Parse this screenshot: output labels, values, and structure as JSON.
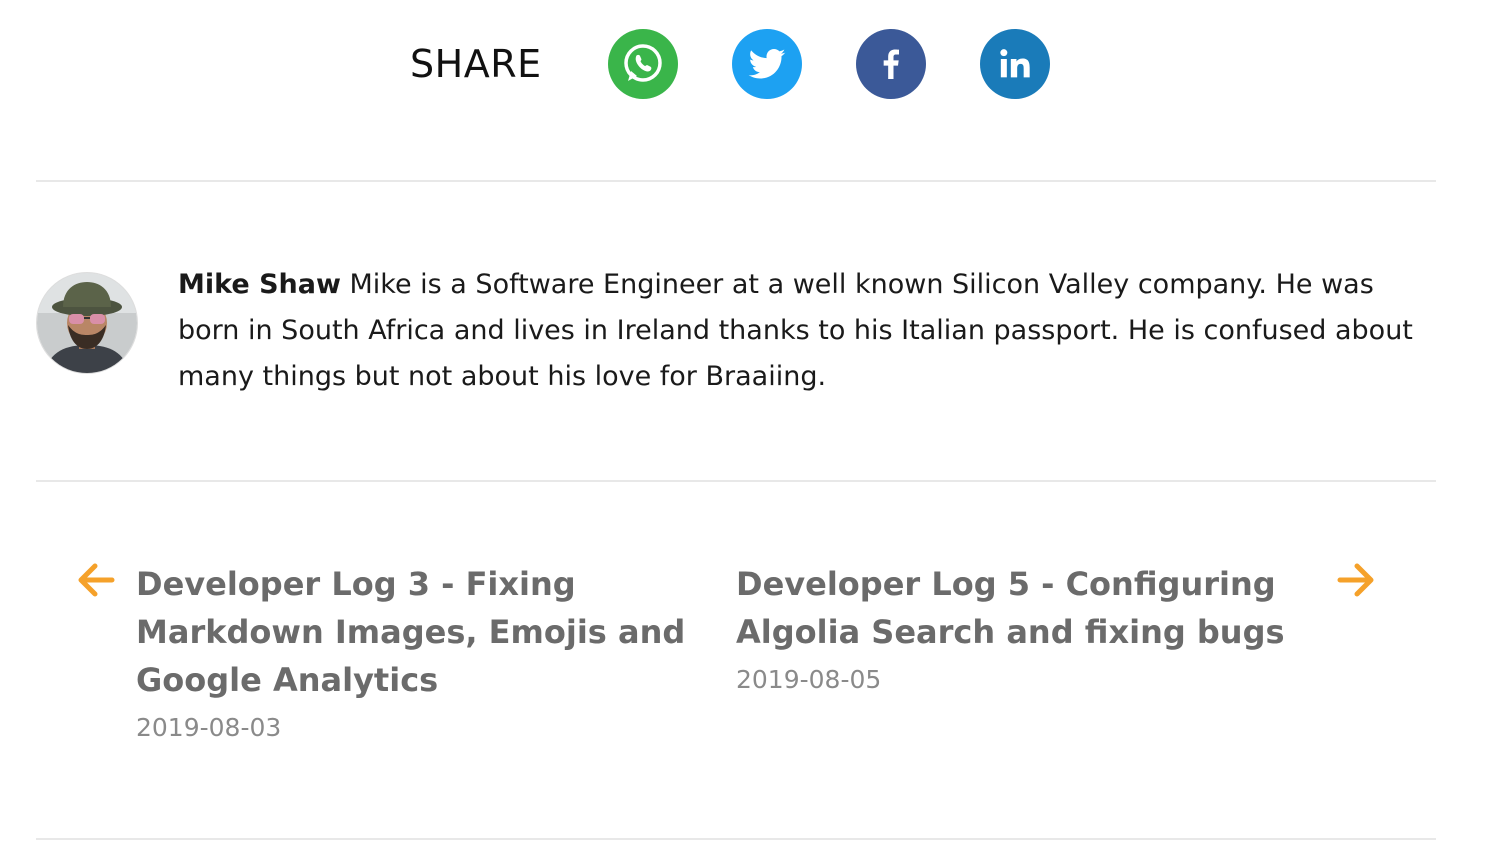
{
  "share": {
    "label": "SHARE",
    "buttons": [
      {
        "name": "whatsapp",
        "icon": "whatsapp-icon",
        "color": "#3ab54a"
      },
      {
        "name": "twitter",
        "icon": "twitter-icon",
        "color": "#1da1f2"
      },
      {
        "name": "facebook",
        "icon": "facebook-icon",
        "color": "#3b5998"
      },
      {
        "name": "linkedin",
        "icon": "linkedin-icon",
        "color": "#1a7bb9"
      }
    ]
  },
  "author": {
    "name": "Mike Shaw",
    "bio": " Mike is a Software Engineer at a well known Silicon Valley company. He was born in South Africa and lives in Ireland thanks to his Italian passport. He is confused about many things but not about his love for Braaiing."
  },
  "post_nav": {
    "arrow_color": "#f5a12a",
    "previous": {
      "title": "Developer Log 3 - Fixing Markdown Images, Emojis and Google Analytics",
      "date": "2019-08-03"
    },
    "next": {
      "title": "Developer Log 5 - Configuring Algolia Search and fixing bugs",
      "date": "2019-08-05"
    }
  }
}
